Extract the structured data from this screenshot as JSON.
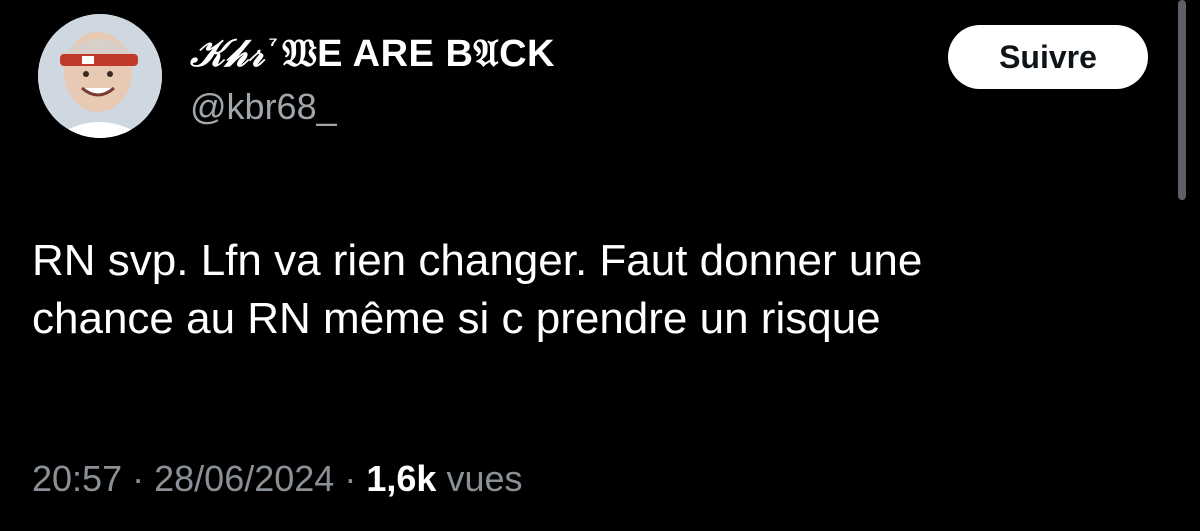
{
  "user": {
    "display_name_fancy": "𝒦𝒽𝓇",
    "display_name_sup": "⁷",
    "display_name_rest": "𝔚E ARE B𝔄CK",
    "handle": "@kbr68_"
  },
  "follow_button": {
    "label": "Suivre"
  },
  "tweet": {
    "lines": [
      "RN svp. Lfn va rien changer. Faut donner une",
      "chance au RN même si c prendre un risque"
    ]
  },
  "meta": {
    "time": "20:57",
    "separator": "·",
    "date": "28/06/2024",
    "views_count": "1,6k",
    "views_label": "vues"
  },
  "colors": {
    "background": "#000000",
    "text": "#ffffff",
    "secondary_text": "#8b9096",
    "button_bg": "#ffffff"
  },
  "icons": {
    "avatar": "profile-photo"
  }
}
